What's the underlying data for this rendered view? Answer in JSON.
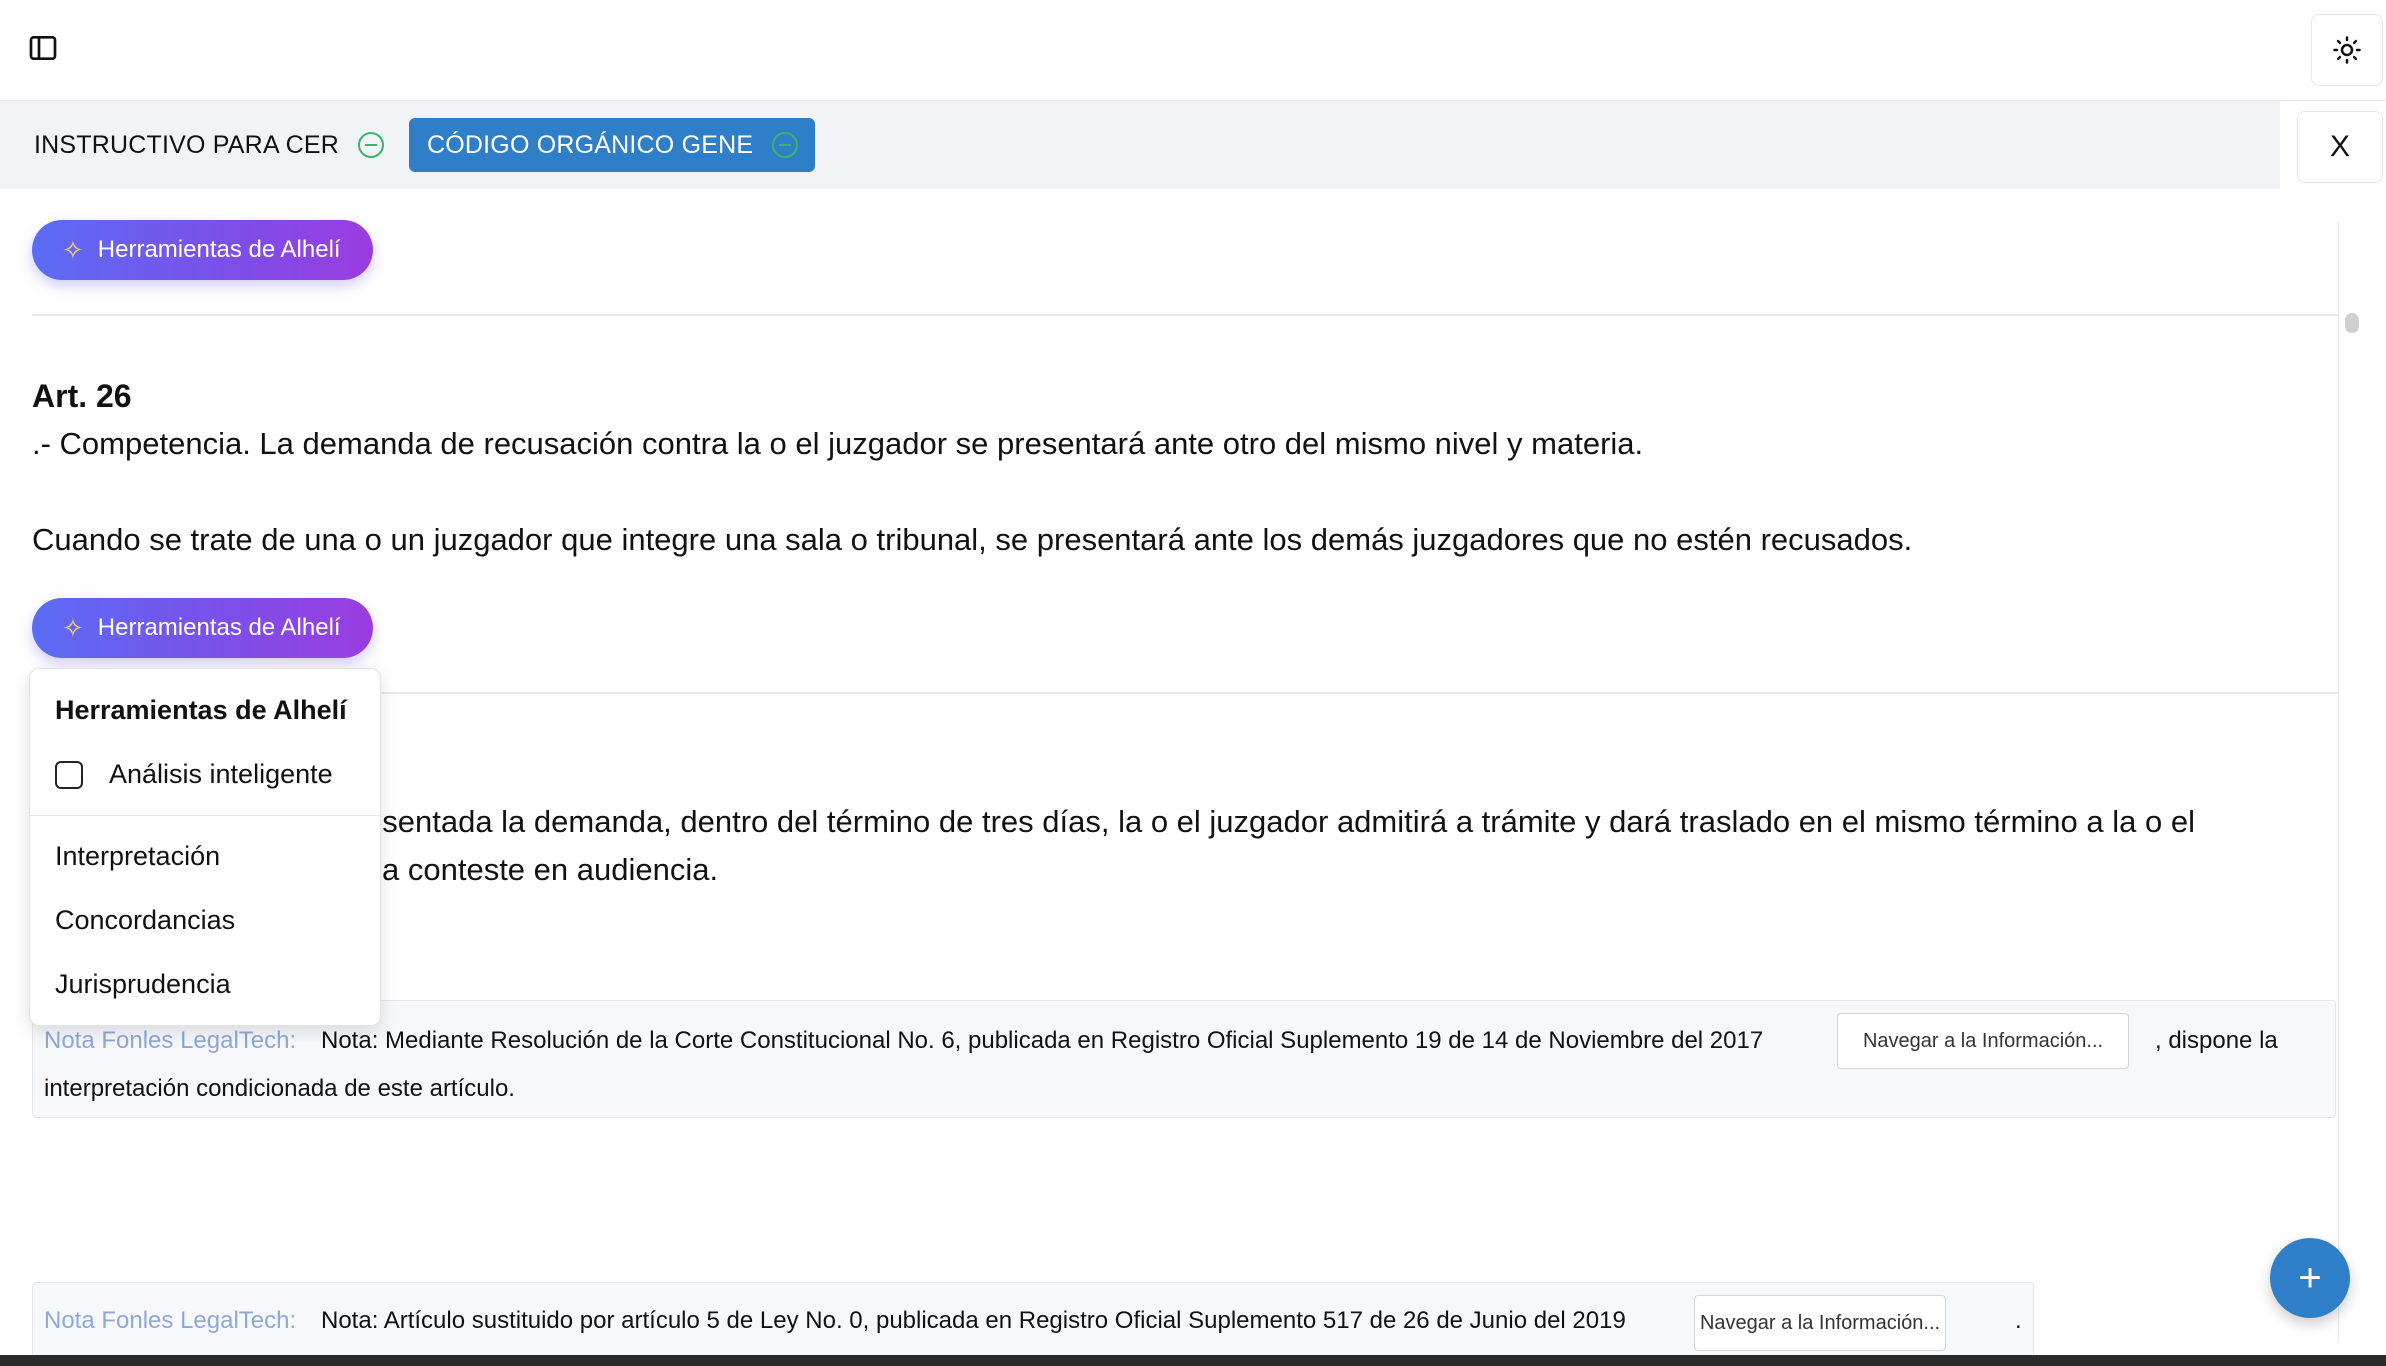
{
  "header": {
    "sidebar_icon": "sidebar-panel-icon",
    "theme_icon": "sun-icon"
  },
  "tabs": [
    {
      "label": "INSTRUCTIVO PARA CER",
      "active": false
    },
    {
      "label": "CÓDIGO ORGÁNICO GENE",
      "active": true
    }
  ],
  "close_tabs_label": "X",
  "tools_button_label": "Herramientas de Alhelí",
  "article": {
    "title": "Art. 26",
    "line1": ".- Competencia. La demanda de recusación contra la o el juzgador se presentará ante otro del mismo nivel y materia.",
    "line2": "Cuando se trate de una o un juzgador que integre una sala o tribunal, se presentará ante los demás juzgadores que no estén recusados."
  },
  "article_next": {
    "line1": "esentada la demanda, dentro del término de tres días, la o el juzgador admitirá a trámite y dará traslado en el mismo término a la o el",
    "line2": "a conteste en audiencia."
  },
  "tools_menu": {
    "title": "Herramientas de Alhelí",
    "checkbox_label": "Análisis inteligente",
    "items": [
      "Interpretación",
      "Concordancias",
      "Jurisprudencia"
    ]
  },
  "notes": [
    {
      "label": "Nota Fonles LegalTech:",
      "text": "Nota: Mediante Resolución de la Corte Constitucional No. 6, publicada en Registro Oficial Suplemento 19 de 14 de Noviembre del 2017",
      "button": "Navegar a la Información...",
      "after": ", dispone la",
      "continuation": "interpretación condicionada de este artículo."
    },
    {
      "label": "Nota Fonles LegalTech:",
      "text": "Nota: Artículo sustituido por artículo 5 de Ley No. 0, publicada en Registro Oficial Suplemento 517 de 26 de Junio del 2019",
      "button": "Navegar a la Información...",
      "after": "."
    }
  ],
  "fab_label": "+",
  "colors": {
    "accent": "#2f7fc8",
    "gradient_start": "#5b6cf5",
    "gradient_end": "#9b3ce0",
    "note_label": "#8fa8d6"
  }
}
